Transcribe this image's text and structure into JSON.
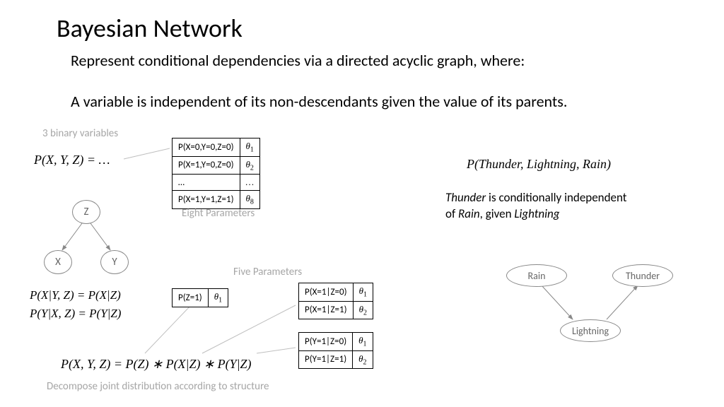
{
  "title": "Bayesian Network",
  "subtitle1": "Represent conditional dependencies via a directed acyclic graph, where:",
  "subtitle2": "A variable is independent of its non-descendants given the value of its parents.",
  "left": {
    "binary_label": "3 binary variables",
    "joint_formula": "P(X, Y, Z) =   …",
    "eight_label": "Eight Parameters",
    "joint_rows": [
      {
        "p": "P(X=0,Y=0,Z=0)",
        "theta": "θ",
        "sub": "1"
      },
      {
        "p": "P(X=1,Y=0,Z=0)",
        "theta": "θ",
        "sub": "2"
      },
      {
        "p": "…",
        "theta": "…",
        "sub": ""
      },
      {
        "p": "P(X=1,Y=1,Z=1)",
        "theta": "θ",
        "sub": "8"
      }
    ],
    "nodes": {
      "z": "Z",
      "x": "X",
      "y": "Y"
    },
    "ci1": "P(X|Y, Z) = P(X|Z)",
    "ci2": "P(Y|X, Z) = P(Y|Z)",
    "five_label": "Five Parameters",
    "cpt_z": [
      {
        "p": "P(Z=1)",
        "theta": "θ",
        "sub": "1"
      }
    ],
    "cpt_x": [
      {
        "p": "P(X=1|Z=0)",
        "theta": "θ",
        "sub": "1"
      },
      {
        "p": "P(X=1|Z=1)",
        "theta": "θ",
        "sub": "2"
      }
    ],
    "cpt_y": [
      {
        "p": "P(Y=1|Z=0)",
        "theta": "θ",
        "sub": "1"
      },
      {
        "p": "P(Y=1|Z=1)",
        "theta": "θ",
        "sub": "2"
      }
    ],
    "factorization": "P(X, Y, Z) = P(Z) ∗ P(X|Z) ∗ P(Y|Z)",
    "decompose_label": "Decompose joint distribution according to structure"
  },
  "right": {
    "head": "P(Thunder, Lightning, Rain)",
    "line1_a": "Thunder",
    "line1_b": " is conditionally independent",
    "line2_a": "of ",
    "line2_b": "Rain",
    "line2_c": ", given ",
    "line2_d": "Lightning",
    "nodes": {
      "rain": "Rain",
      "thunder": "Thunder",
      "lightning": "Lightning"
    }
  }
}
